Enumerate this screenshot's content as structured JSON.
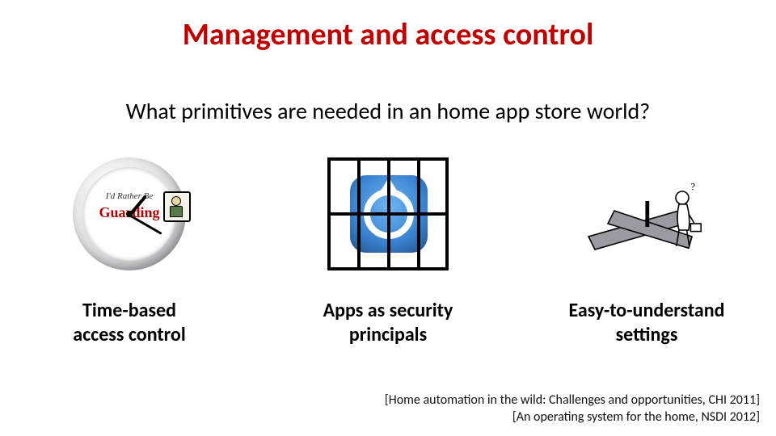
{
  "title": "Management and access control",
  "subtitle": "What primitives are needed in an home app store world?",
  "columns": [
    {
      "caption": "Time-based\naccess control",
      "clock_line1": "I'd Rather Be",
      "clock_line2": "Guarding"
    },
    {
      "caption": "Apps as security\nprincipals"
    },
    {
      "caption": "Easy-to-understand\nsettings"
    }
  ],
  "references": [
    "[Home automation in the wild: Challenges and opportunities, CHI 2011]",
    "[An operating system for the home, NSDI 2012]"
  ]
}
